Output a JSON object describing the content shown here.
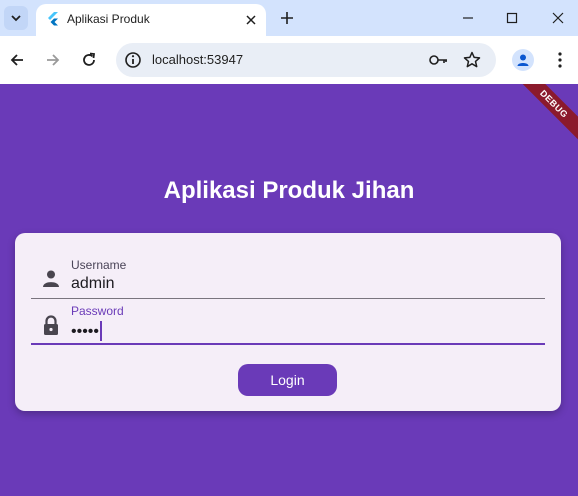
{
  "browser": {
    "tab_title": "Aplikasi Produk",
    "url": "localhost:53947"
  },
  "app": {
    "debug_banner": "DEBUG",
    "title": "Aplikasi Produk Jihan",
    "accent_color": "#6a3ab8",
    "username_field": {
      "label": "Username",
      "value": "admin",
      "icon": "person-icon"
    },
    "password_field": {
      "label": "Password",
      "value": "•••••",
      "icon": "lock-icon",
      "focused": true
    },
    "login_label": "Login"
  }
}
